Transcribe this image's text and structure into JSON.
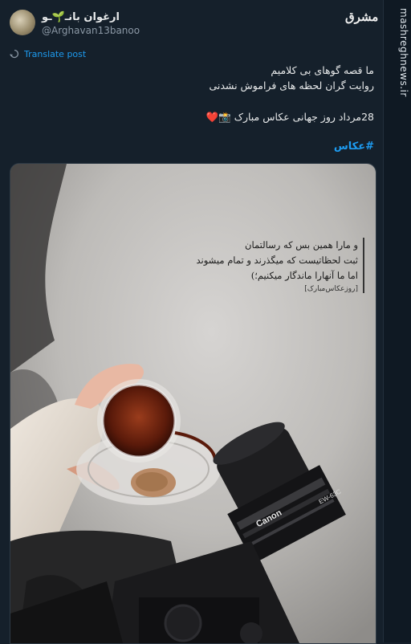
{
  "watermark": {
    "side_text": "mashreghnews.ir",
    "logo_text": "مشرق"
  },
  "author": {
    "display_name": "ارغوان بانـ🌱ـو",
    "handle": "@Arghavan13banoo"
  },
  "translate": {
    "label": "Translate post"
  },
  "tweet": {
    "line1": "ما قصه گوهای بی کلامیم",
    "line2": "روایت گران لحظه های فراموش نشدنی",
    "line3": "28مرداد روز جهانی عکاس مبارک 📸❤️",
    "hashtag": "#عکاس"
  },
  "image_overlay": {
    "quote_line1": "و مارا همین بس که رسالتمان",
    "quote_line2": "ثبت لحظاتیست که میگذرند و تمام میشوند",
    "quote_line3": "اما ما آنهارا ماندگار میکنیم؛)",
    "quote_caption": "[روزعکاس‌مبارک]",
    "camera_brand": "Canon",
    "lens_hood_code": "EW-63C"
  },
  "colors": {
    "background": "#15202b",
    "link": "#1d9bf0",
    "muted": "#8b98a5"
  },
  "icons": {
    "translate": "translate-icon"
  }
}
